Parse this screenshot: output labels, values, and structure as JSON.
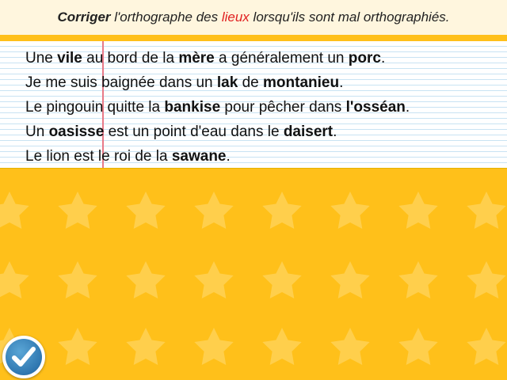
{
  "instruction": {
    "part1": "Corriger",
    "part2": " l'orthographe des ",
    "part3": "lieux",
    "part4": " lorsqu'ils sont mal orthographiés."
  },
  "sentences": [
    {
      "segments": [
        {
          "text": "Une ",
          "bold": false
        },
        {
          "text": "vile",
          "bold": true
        },
        {
          "text": " au bord de la ",
          "bold": false
        },
        {
          "text": "mère",
          "bold": true
        },
        {
          "text": " a généralement un ",
          "bold": false
        },
        {
          "text": "porc",
          "bold": true
        },
        {
          "text": ".",
          "bold": false
        }
      ]
    },
    {
      "segments": [
        {
          "text": "Je me suis baignée dans un ",
          "bold": false
        },
        {
          "text": "lak",
          "bold": true
        },
        {
          "text": " de ",
          "bold": false
        },
        {
          "text": "montanieu",
          "bold": true
        },
        {
          "text": ".",
          "bold": false
        }
      ]
    },
    {
      "segments": [
        {
          "text": "Le pingouin quitte la ",
          "bold": false
        },
        {
          "text": "bankise",
          "bold": true
        },
        {
          "text": " pour pêcher dans ",
          "bold": false
        },
        {
          "text": "l'osséan",
          "bold": true
        },
        {
          "text": ".",
          "bold": false
        }
      ]
    },
    {
      "segments": [
        {
          "text": "Un ",
          "bold": false
        },
        {
          "text": "oasisse",
          "bold": true
        },
        {
          "text": " est un point d'eau dans le ",
          "bold": false
        },
        {
          "text": "daisert",
          "bold": true
        },
        {
          "text": ".",
          "bold": false
        }
      ]
    },
    {
      "segments": [
        {
          "text": "Le lion est le roi de la ",
          "bold": false
        },
        {
          "text": "sawane",
          "bold": true
        },
        {
          "text": ".",
          "bold": false
        }
      ]
    }
  ],
  "check_button": {
    "icon": "checkmark-icon"
  },
  "colors": {
    "background": "#FFC01A",
    "star": "#FFCF4C",
    "header_bg": "#FFF6DE",
    "highlight_red": "#E02020",
    "paper_rule": "#C9E3F3",
    "margin_line": "#E87A88",
    "button_blue": "#2F77B0"
  }
}
